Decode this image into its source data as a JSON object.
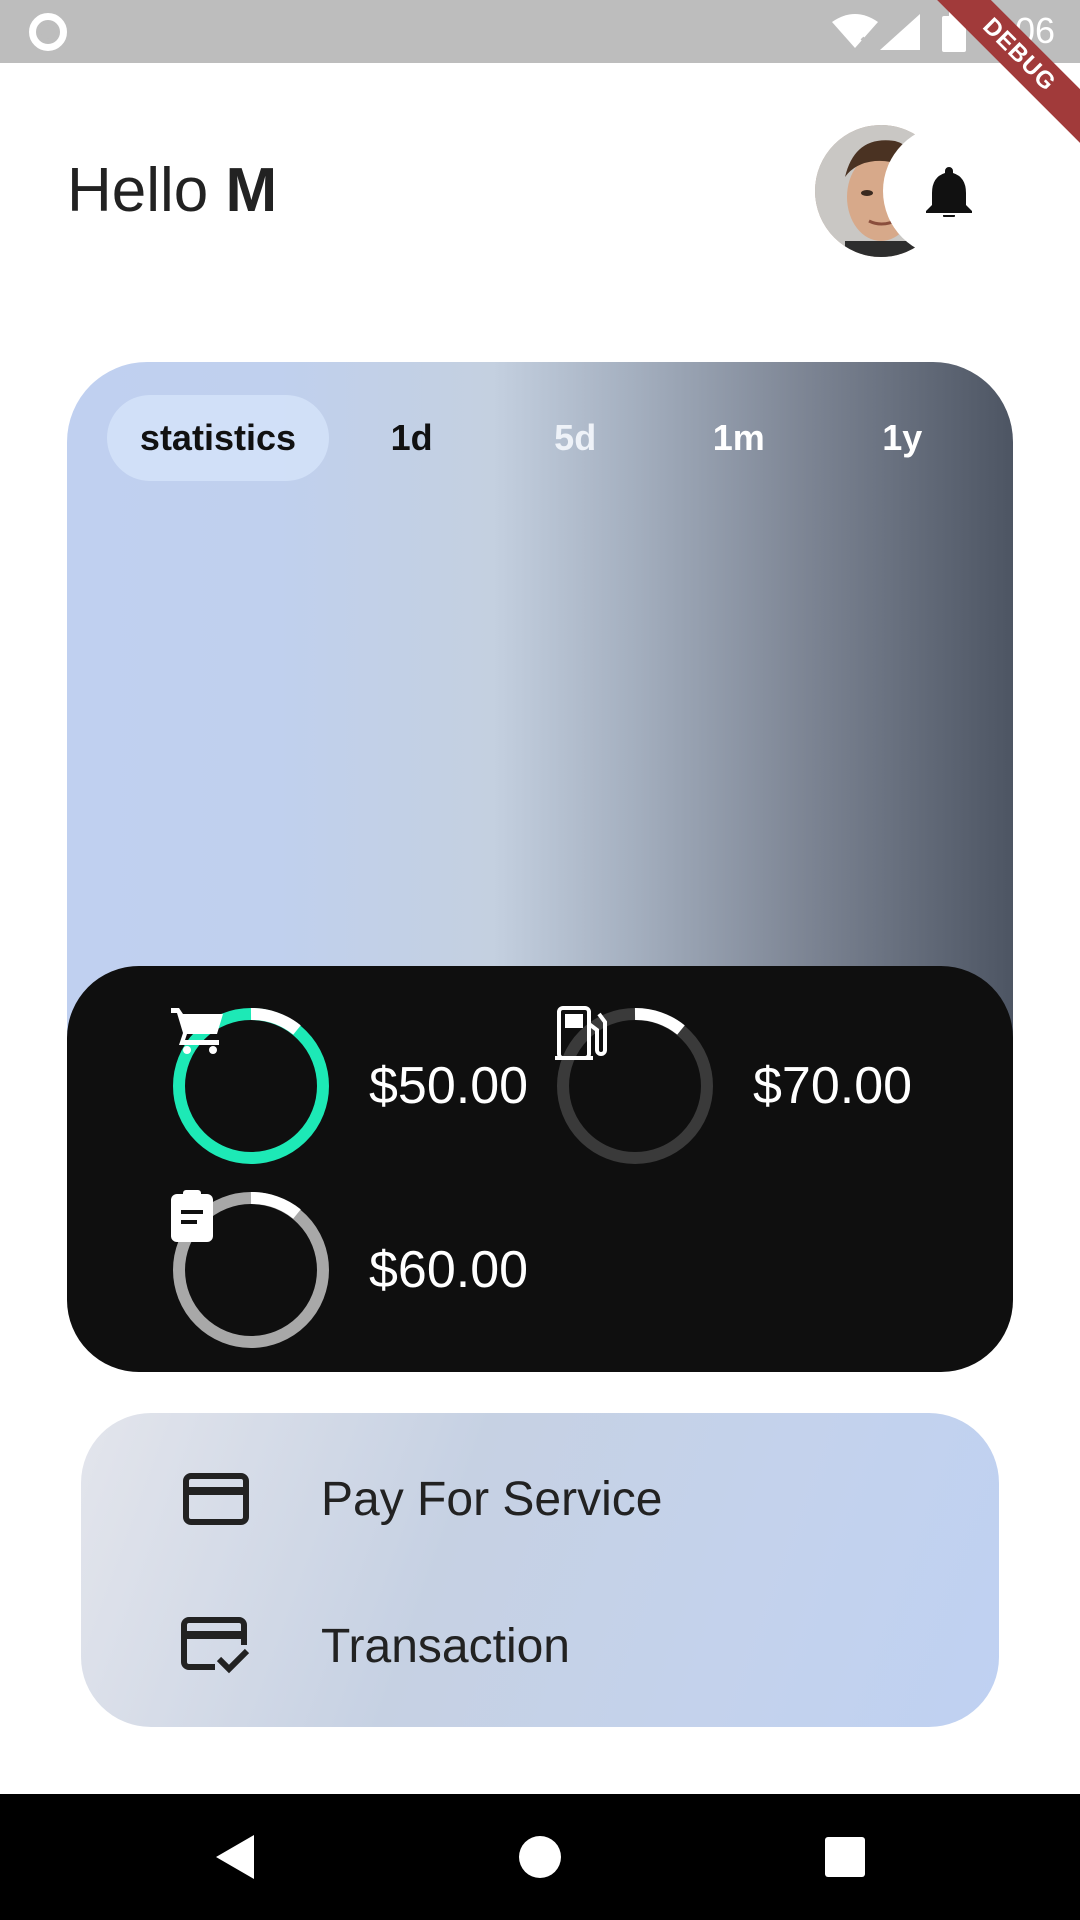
{
  "status_bar": {
    "time": "6:06",
    "debug_label": "DEBUG",
    "icons": [
      "record-icon",
      "wifi-icon",
      "cell-signal-icon",
      "battery-icon"
    ]
  },
  "header": {
    "greeting": "Hello",
    "name": "M",
    "avatar": "avatar-photo",
    "notification_icon": "bell-icon"
  },
  "stats": {
    "tabs": [
      {
        "label": "statistics",
        "active": true
      },
      {
        "label": "1d",
        "active": false
      },
      {
        "label": "5d",
        "active": false
      },
      {
        "label": "1m",
        "active": false
      },
      {
        "label": "1y",
        "active": false
      }
    ],
    "gradient_colors": [
      "#c0d0f0",
      "#c4d0e0",
      "#7d8594",
      "#4d5563"
    ]
  },
  "summary": {
    "items": [
      {
        "icon": "shopping-cart-icon",
        "amount": "$50.00",
        "ring_color": "#1de9b6",
        "progress": 1.0
      },
      {
        "icon": "gas-pump-icon",
        "amount": "$70.00",
        "ring_color": "#3a3a3a",
        "progress": 0.15
      },
      {
        "icon": "clipboard-icon",
        "amount": "$60.00",
        "ring_color": "#a8a8a8",
        "progress": 0.9
      }
    ]
  },
  "actions": [
    {
      "icon": "credit-card-icon",
      "label": "Pay For Service"
    },
    {
      "icon": "card-check-icon",
      "label": "Transaction"
    }
  ],
  "nav": [
    "back-icon",
    "home-icon",
    "recents-icon"
  ]
}
